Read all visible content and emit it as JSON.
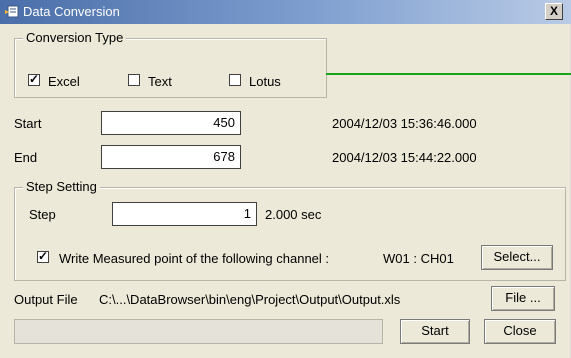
{
  "window": {
    "title": "Data Conversion",
    "close_glyph": "X"
  },
  "conversion": {
    "group_label": "Conversion Type",
    "options": [
      {
        "label": "Excel",
        "checked": true
      },
      {
        "label": "Text",
        "checked": false
      },
      {
        "label": "Lotus",
        "checked": false
      }
    ]
  },
  "range": {
    "start_label": "Start",
    "start_value": "450",
    "start_time": "2004/12/03 15:36:46.000",
    "end_label": "End",
    "end_value": "678",
    "end_time": "2004/12/03 15:44:22.000"
  },
  "step": {
    "group_label": "Step Setting",
    "label": "Step",
    "value": "1",
    "interval": "2.000 sec",
    "write_label": "Write Measured point of the following channel :",
    "write_checked": true,
    "channel": "W01 : CH01",
    "select_button": "Select..."
  },
  "output": {
    "label": "Output File",
    "path": "C:\\...\\DataBrowser\\bin\\eng\\Project\\Output\\Output.xls",
    "file_button": "File ..."
  },
  "footer": {
    "start_button": "Start",
    "close_button": "Close",
    "progress": 0
  },
  "colors": {
    "accent_line": "#19a319",
    "title_gradient_start": "#4a6ea9"
  }
}
